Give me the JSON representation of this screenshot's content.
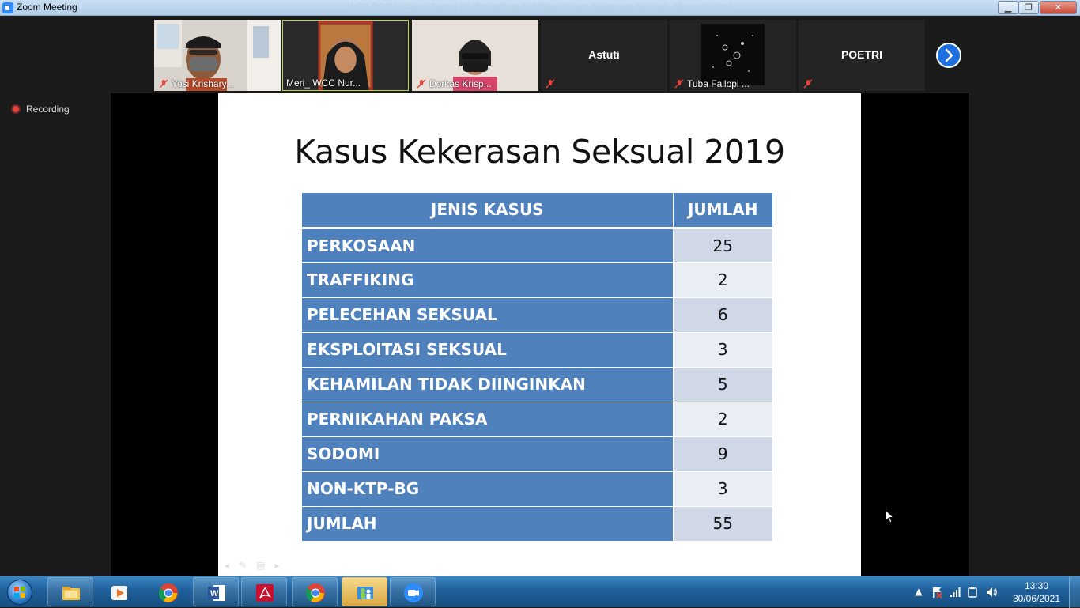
{
  "window": {
    "title": "Zoom Meeting",
    "ghost_title": "WCC-PCCU: Diskusi Daring 30 Minuteshare Kebijakan Sistem Kekerasan Seksual - Microsoft Word"
  },
  "participants": [
    {
      "name": "Yosi Krishary...",
      "muted": true
    },
    {
      "name": "Meri_ WCC Nur...",
      "muted": false,
      "active": true
    },
    {
      "name": "Dorkas Krisp...",
      "muted": true
    },
    {
      "name": "Astuti",
      "muted": true,
      "no_video": true
    },
    {
      "name": "Tuba Fallopi ...",
      "muted": true
    },
    {
      "name": "POETRI",
      "muted": true,
      "no_video": true
    }
  ],
  "recording": {
    "label": "Recording"
  },
  "slide": {
    "title": "Kasus Kekerasan Seksual 2019",
    "headers": [
      "JENIS KASUS",
      "JUMLAH"
    ],
    "rows": [
      {
        "kind": "PERKOSAAN",
        "count": "25"
      },
      {
        "kind": "TRAFFIKING",
        "count": "2"
      },
      {
        "kind": "PELECEHAN SEKSUAL",
        "count": "6"
      },
      {
        "kind": "EKSPLOITASI SEKSUAL",
        "count": "3"
      },
      {
        "kind": "KEHAMILAN TIDAK DIINGINKAN",
        "count": "5"
      },
      {
        "kind": "PERNIKAHAN PAKSA",
        "count": "2"
      },
      {
        "kind": "SODOMI",
        "count": "9"
      },
      {
        "kind": "NON-KTP-BG",
        "count": "3"
      },
      {
        "kind": "JUMLAH",
        "count": "55"
      }
    ]
  },
  "taskbar": {
    "apps": [
      "file-explorer",
      "media-player",
      "chrome",
      "word",
      "acrobat",
      "chrome",
      "network-app",
      "zoom"
    ],
    "time": "13:30",
    "date": "30/06/2021"
  },
  "colors": {
    "table_header": "#4f81bd",
    "cell_odd": "#d0d8e8",
    "cell_even": "#e9edf4",
    "zoom_blue": "#2d8cff"
  }
}
